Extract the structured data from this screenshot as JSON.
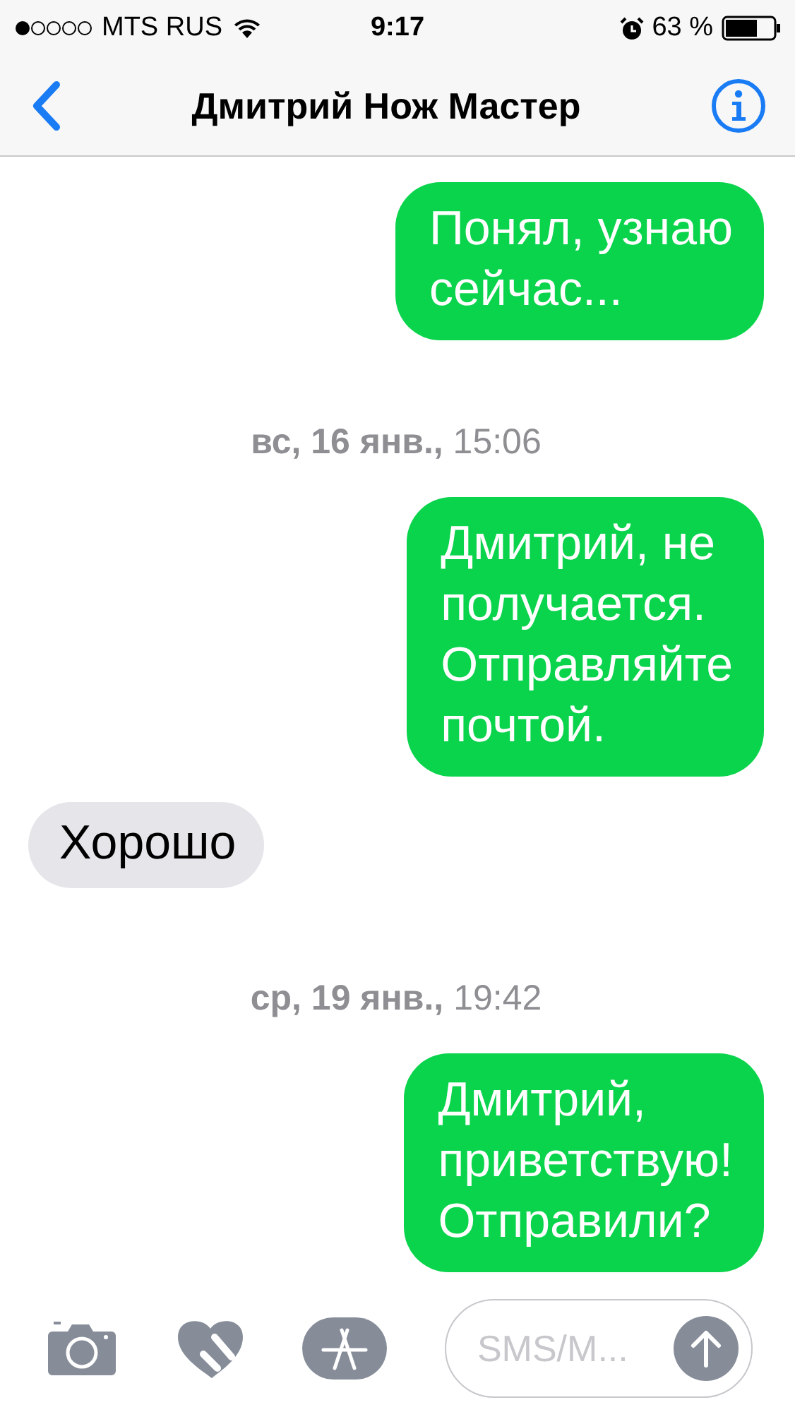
{
  "status_bar": {
    "carrier": "MTS RUS",
    "time": "9:17",
    "battery": "63 %"
  },
  "nav": {
    "title": "Дмитрий Нож Мастер"
  },
  "messages": [
    {
      "kind": "outgoing",
      "text": "Понял, узнаю\nсейчас..."
    },
    {
      "kind": "date",
      "text": "**вс, 16 янв.,** 15:06"
    },
    {
      "kind": "outgoing",
      "text": "Дмитрий, не\nполучается.\nОтправляйте\nпочтой."
    },
    {
      "kind": "incoming",
      "text": "Хорошо"
    },
    {
      "kind": "date",
      "text": "**ср, 19 янв.,** 19:42"
    },
    {
      "kind": "outgoing",
      "text": "Дмитрий,\nприветствую!\nОтправили?"
    }
  ],
  "composer": {
    "placeholder": "SMS/M..."
  }
}
